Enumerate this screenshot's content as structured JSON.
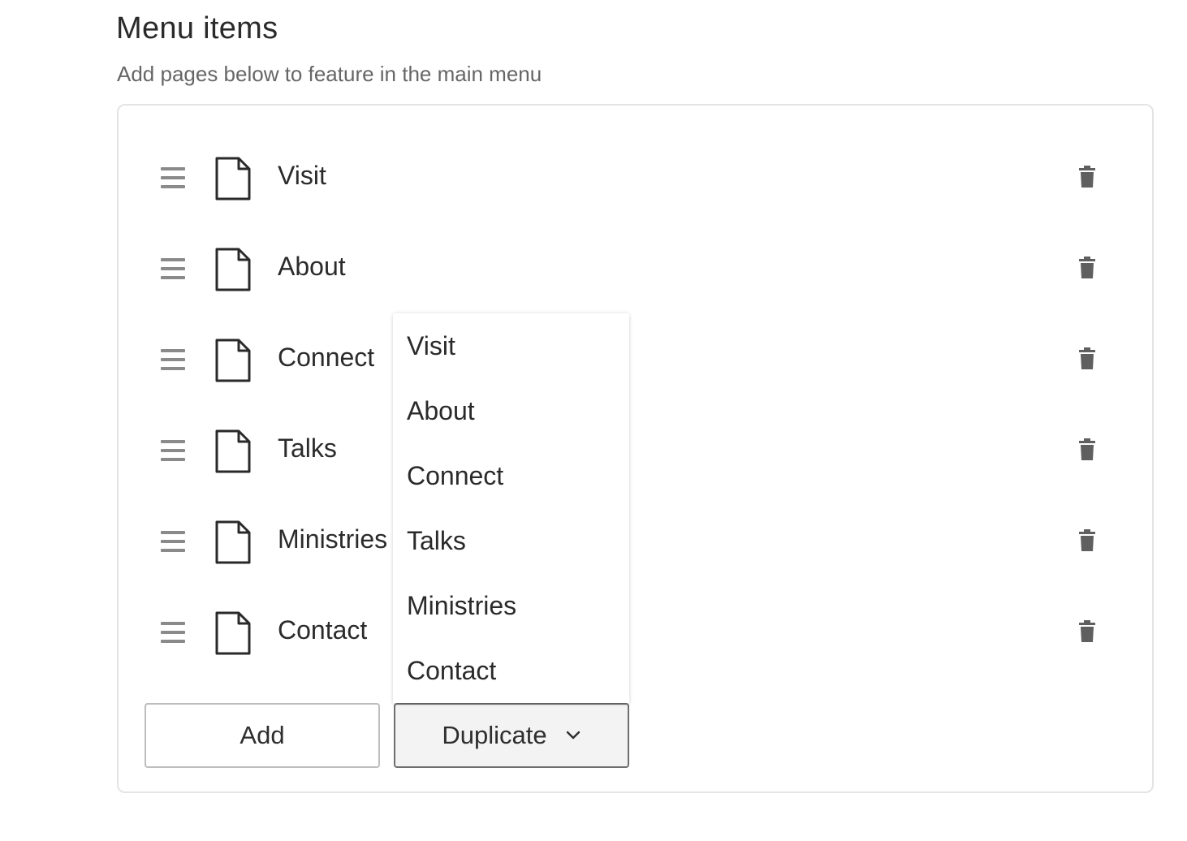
{
  "header": {
    "title": "Menu items",
    "subtitle": "Add pages below to feature in the main menu"
  },
  "menu": {
    "items": [
      {
        "label": "Visit"
      },
      {
        "label": "About"
      },
      {
        "label": "Connect"
      },
      {
        "label": "Talks"
      },
      {
        "label": "Ministries"
      },
      {
        "label": "Contact"
      }
    ]
  },
  "actions": {
    "add_label": "Add",
    "duplicate_label": "Duplicate"
  },
  "dropdown": {
    "options": [
      "Visit",
      "About",
      "Connect",
      "Talks",
      "Ministries",
      "Contact"
    ]
  },
  "icons": {
    "drag": "drag-handle-icon",
    "page": "page-icon",
    "delete": "trash-icon",
    "chevron": "chevron-down-icon"
  },
  "colors": {
    "border": "#e4e4e4",
    "icon_gray": "#8a8a8a",
    "trash": "#5f5f5f",
    "dropdown_button_bg": "#f3f3f3"
  }
}
